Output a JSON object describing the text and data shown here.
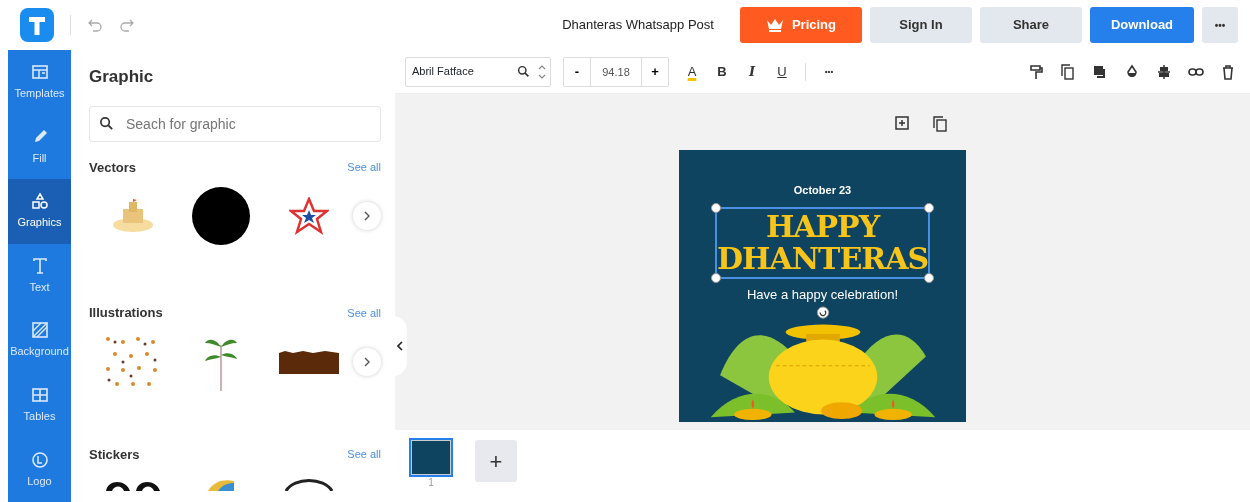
{
  "header": {
    "title": "Dhanteras Whatsapp Post",
    "buttons": [
      {
        "label": "Pricing",
        "kind": "pricing"
      },
      {
        "label": "Sign In",
        "kind": "plain"
      },
      {
        "label": "Share",
        "kind": "plain"
      },
      {
        "label": "Download",
        "kind": "primary"
      },
      {
        "label": "•••",
        "kind": "more"
      }
    ]
  },
  "sidebar": {
    "items": [
      {
        "label": "Templates",
        "selected": false
      },
      {
        "label": "Fill",
        "selected": false
      },
      {
        "label": "Graphics",
        "selected": true
      },
      {
        "label": "Text",
        "selected": false
      },
      {
        "label": "Background",
        "selected": false
      },
      {
        "label": "Tables",
        "selected": false
      },
      {
        "label": "Logo",
        "selected": false
      }
    ]
  },
  "panel": {
    "title": "Graphic",
    "search": {
      "placeholder": "Seach for graphic"
    },
    "sections": [
      {
        "title": "Vectors",
        "link": "See all"
      },
      {
        "title": "Illustrations",
        "link": "See all"
      },
      {
        "title": "Stickers",
        "link": "See all"
      }
    ]
  },
  "toolbar": {
    "font": "Abril Fatface",
    "minus": "-",
    "size": "94.18",
    "plus": "+",
    "format": [
      "A",
      "B",
      "I",
      "U"
    ],
    "more": "•••"
  },
  "design": {
    "date": "October 23",
    "headline": [
      "HAPPY",
      "DHANTERAS"
    ],
    "subtitle": "Have a happy celebration!"
  },
  "pages": [
    {
      "number": "1",
      "selected": true
    }
  ],
  "add_page": "+"
}
